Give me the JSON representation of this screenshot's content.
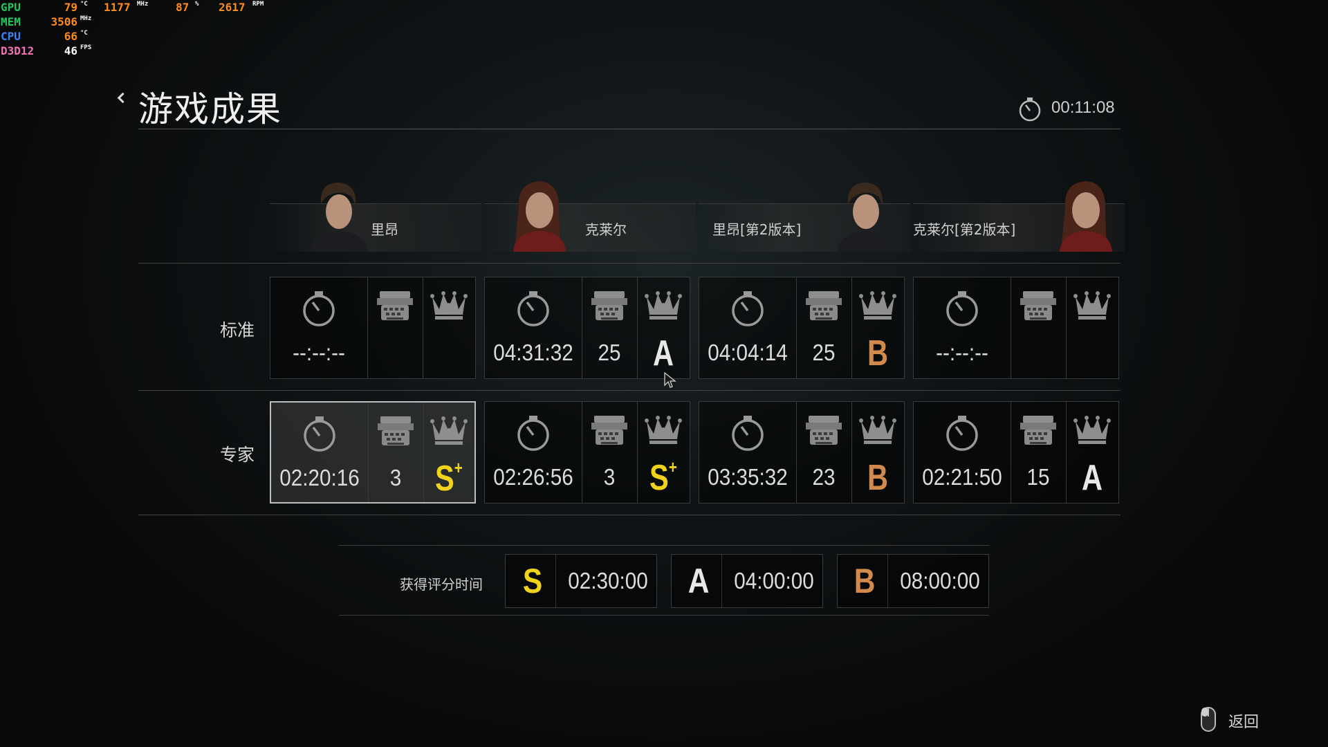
{
  "hud": [
    {
      "label": "GPU",
      "color": "#22c55e",
      "v1": "79",
      "u1": "°C",
      "v2": "1177",
      "u2": "MHz",
      "v3": "87",
      "u3": "%",
      "v4": "2617",
      "u4": "RPM"
    },
    {
      "label": "MEM",
      "color": "#22c55e",
      "v1": "3506",
      "u1": "MHz"
    },
    {
      "label": "CPU",
      "color": "#3b82f6",
      "v1": "66",
      "u1": "°C"
    },
    {
      "label": "D3D12",
      "color": "#f472b6",
      "v1": "46",
      "u1": "FPS",
      "v1color": "#ffffff"
    }
  ],
  "header": {
    "title": "游戏成果",
    "play_time": "00:11:08"
  },
  "characters": [
    "里昂",
    "克莱尔",
    "里昂[第2版本]",
    "克莱尔[第2版本]"
  ],
  "difficulties": [
    {
      "label": "标准",
      "results": [
        {
          "time": "--:--:--",
          "saves": "",
          "rank": "",
          "suffix": ""
        },
        {
          "time": "04:31:32",
          "saves": "25",
          "rank": "A",
          "suffix": ""
        },
        {
          "time": "04:04:14",
          "saves": "25",
          "rank": "B",
          "suffix": ""
        },
        {
          "time": "--:--:--",
          "saves": "",
          "rank": "",
          "suffix": ""
        }
      ]
    },
    {
      "label": "专家",
      "results": [
        {
          "time": "02:20:16",
          "saves": "3",
          "rank": "S",
          "suffix": "+"
        },
        {
          "time": "02:26:56",
          "saves": "3",
          "rank": "S",
          "suffix": "+"
        },
        {
          "time": "03:35:32",
          "saves": "23",
          "rank": "B",
          "suffix": ""
        },
        {
          "time": "02:21:50",
          "saves": "15",
          "rank": "A",
          "suffix": ""
        }
      ]
    }
  ],
  "rank_times": {
    "label": "获得评分时间",
    "items": [
      {
        "rank": "S",
        "time": "02:30:00"
      },
      {
        "rank": "A",
        "time": "04:00:00"
      },
      {
        "rank": "B",
        "time": "08:00:00"
      }
    ]
  },
  "rank_colors": {
    "S": "#f0d21a",
    "A": "#e8e8e8",
    "B": "#d28a4c"
  },
  "footer": {
    "back_label": "返回"
  }
}
